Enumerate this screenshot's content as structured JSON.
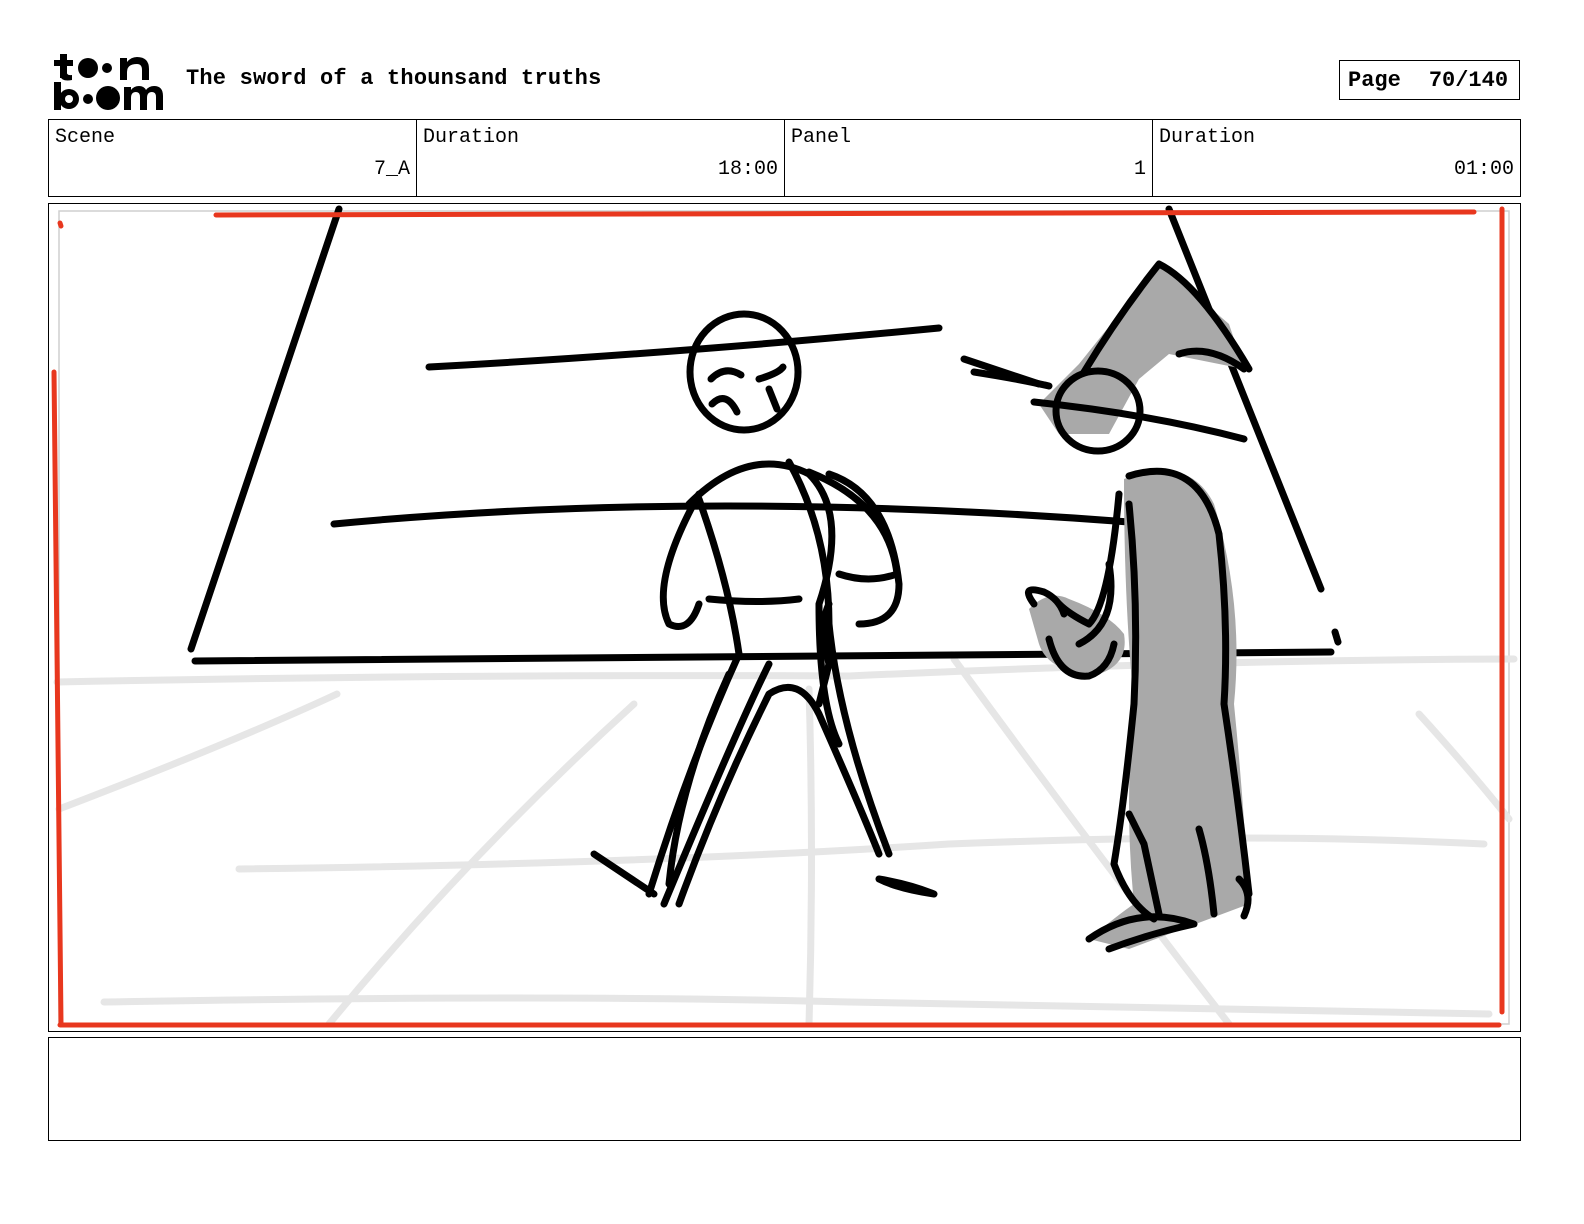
{
  "header": {
    "logo_text": "toon boom",
    "title": "The sword of a thounsand truths",
    "page_label": "Page",
    "page_number": "70/140"
  },
  "info": {
    "scene_label": "Scene",
    "scene_value": "7_A",
    "scene_duration_label": "Duration",
    "scene_duration_value": "18:00",
    "panel_label": "Panel",
    "panel_value": "1",
    "panel_duration_label": "Duration",
    "panel_duration_value": "01:00"
  },
  "panel": {
    "sketch_description": "Rough storyboard sketch: a stick-figure character facing a hooded figure in a grey cloak inside a room with a tiled floor.",
    "safe_frame_color": "#e8371e",
    "ink_color": "#000000",
    "cloak_color": "#a9a9a9",
    "floor_line_color": "#e6e6e6"
  },
  "notes": {
    "text": ""
  }
}
